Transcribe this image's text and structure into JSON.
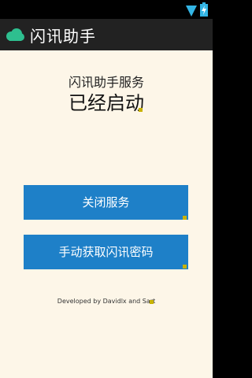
{
  "app": {
    "title": "闪讯助手"
  },
  "status": {
    "subtitle": "闪讯助手服务",
    "state": "已经启动"
  },
  "buttons": {
    "stop_label": "关闭服务",
    "get_password_label": "手动获取闪讯密码"
  },
  "footer": {
    "credits": "Developed by Davidlx and Sart"
  },
  "colors": {
    "accent": "#1e80c8",
    "background": "#fdf6e8",
    "action_bar": "#222222",
    "app_icon": "#2ebf8f"
  },
  "icons": {
    "app": "cloud-icon",
    "signal": "signal-icon",
    "battery": "battery-icon"
  }
}
